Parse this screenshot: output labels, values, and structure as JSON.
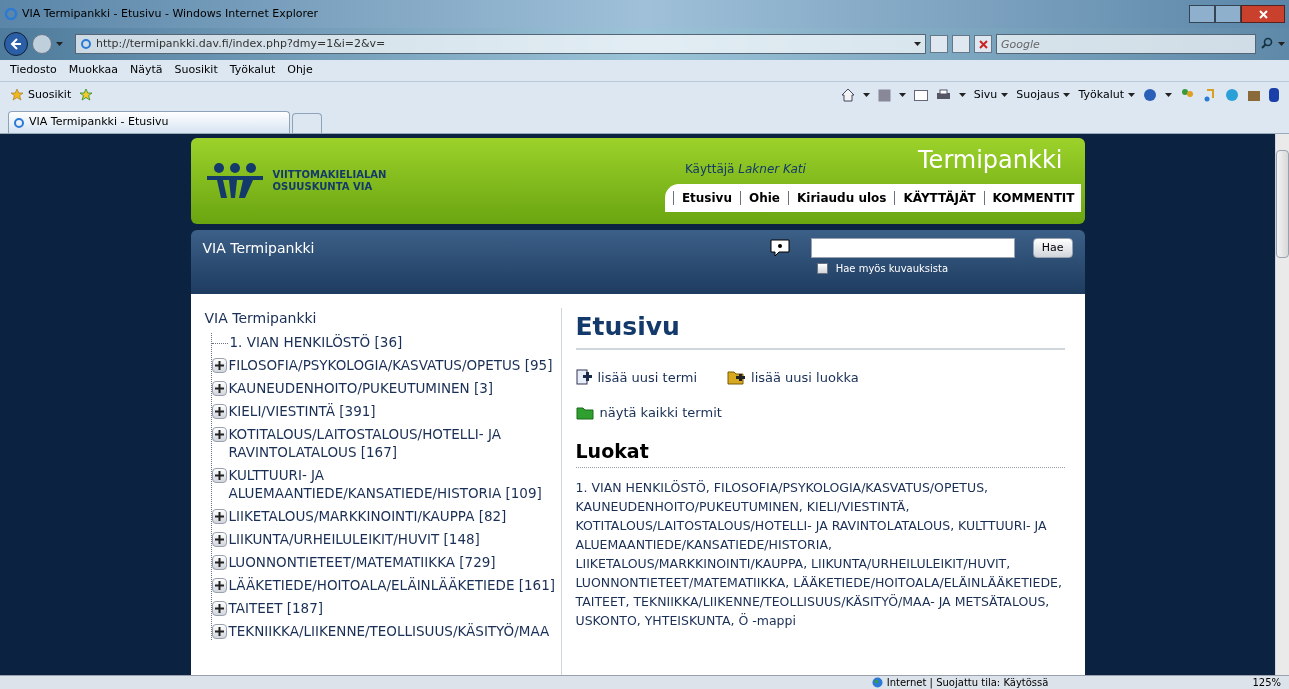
{
  "window": {
    "title": "VIA Termipankki - Etusivu - Windows Internet Explorer"
  },
  "address_bar": {
    "url": "http://termipankki.dav.fi/index.php?dmy=1&i=2&v=",
    "search_placeholder": "Google"
  },
  "menu": [
    "Tiedosto",
    "Muokkaa",
    "Näytä",
    "Suosikit",
    "Työkalut",
    "Ohje"
  ],
  "favorites_bar": {
    "label": "Suosikit",
    "tools": [
      "Sivu",
      "Suojaus",
      "Työkalut"
    ]
  },
  "tabs": [
    {
      "label": "VIA Termipankki - Etusivu",
      "selected": true
    }
  ],
  "page": {
    "logo_lines": [
      "VIITTOMAKIELIALAN",
      "OSUUSKUNTA VIA"
    ],
    "user": "Käyttäjä *Lakner Kati*",
    "site_title": "Termipankki",
    "nav": [
      "Etusivu",
      "Ohie",
      "Kiriaudu ulos",
      "KÄYTTÄJÄT",
      "KOMMENTIT"
    ],
    "bar_title": "VIA Termipankki",
    "search_button": "Hae",
    "search_descriptions": {
      "label": "Hae myös kuvauksista",
      "checked": false
    },
    "tree_title": "VIA Termipankki",
    "tree": [
      {
        "kind": "leaf",
        "label": "1. VIAN HENKILÖSTÖ [36]"
      },
      {
        "kind": "collapsed",
        "label": "FILOSOFIA/PSYKOLOGIA/KASVATUS/OPETUS [95]"
      },
      {
        "kind": "collapsed",
        "label": "KAUNEUDENHOITO/PUKEUTUMINEN [3]"
      },
      {
        "kind": "collapsed",
        "label": "KIELI/VIESTINTÄ [391]"
      },
      {
        "kind": "collapsed",
        "label": "KOTITALOUS/LAITOSTALOUS/HOTELLI- JA RAVINTOLATALOUS [167]"
      },
      {
        "kind": "collapsed",
        "label": "KULTTUURI- JA ALUEMAANTIEDE/KANSATIEDE/HISTORIA [109]"
      },
      {
        "kind": "collapsed",
        "label": "LIIKETALOUS/MARKKINOINTI/KAUPPA [82]"
      },
      {
        "kind": "collapsed",
        "label": "LIIKUNTA/URHEILULEIKIT/HUVIT [148]"
      },
      {
        "kind": "collapsed",
        "label": "LUONNONTIETEET/MATEMATIIKKA [729]"
      },
      {
        "kind": "collapsed",
        "label": "LÄÄKETIEDE/HOITOALA/ELÄINLÄÄKETIEDE [161]"
      },
      {
        "kind": "collapsed",
        "label": "TAITEET [187]"
      },
      {
        "kind": "collapsed",
        "label": "TEKNIIKKA/LIIKENNE/TEOLLISUUS/KÄSITYÖ/MAA"
      }
    ],
    "heading": "Etusivu",
    "actions": [
      {
        "kind": "term",
        "label": "lisää uusi termi"
      },
      {
        "kind": "category",
        "label": "lisää uusi luokka"
      },
      {
        "kind": "all",
        "label": "näytä kaikki termit"
      }
    ],
    "categories_heading": "Luokat",
    "categories_text": "1. VIAN HENKILÖSTÖ, FILOSOFIA/PSYKOLOGIA/KASVATUS/OPETUS, KAUNEUDENHOITO/PUKEUTUMINEN, KIELI/VIESTINTÄ, KOTITALOUS/LAITOSTALOUS/HOTELLI- JA RAVINTOLATALOUS, KULTTUURI- JA ALUEMAANTIEDE/KANSATIEDE/HISTORIA, LIIKETALOUS/MARKKINOINTI/KAUPPA, LIIKUNTA/URHEILULEIKIT/HUVIT, LUONNONTIETEET/MATEMATIIKKA, LÄÄKETIEDE/HOITOALA/ELÄINLÄÄKETIEDE, TAITEET, TEKNIIKKA/LIIKENNE/TEOLLISUUS/KÄSITYÖ/MAA- JA METSÄTALOUS, USKONTO, YHTEISKUNTA, Ö -mappi"
  },
  "status_bar": {
    "zone": "Internet | Suojattu tila: Käytössä",
    "zoom": "125%"
  }
}
